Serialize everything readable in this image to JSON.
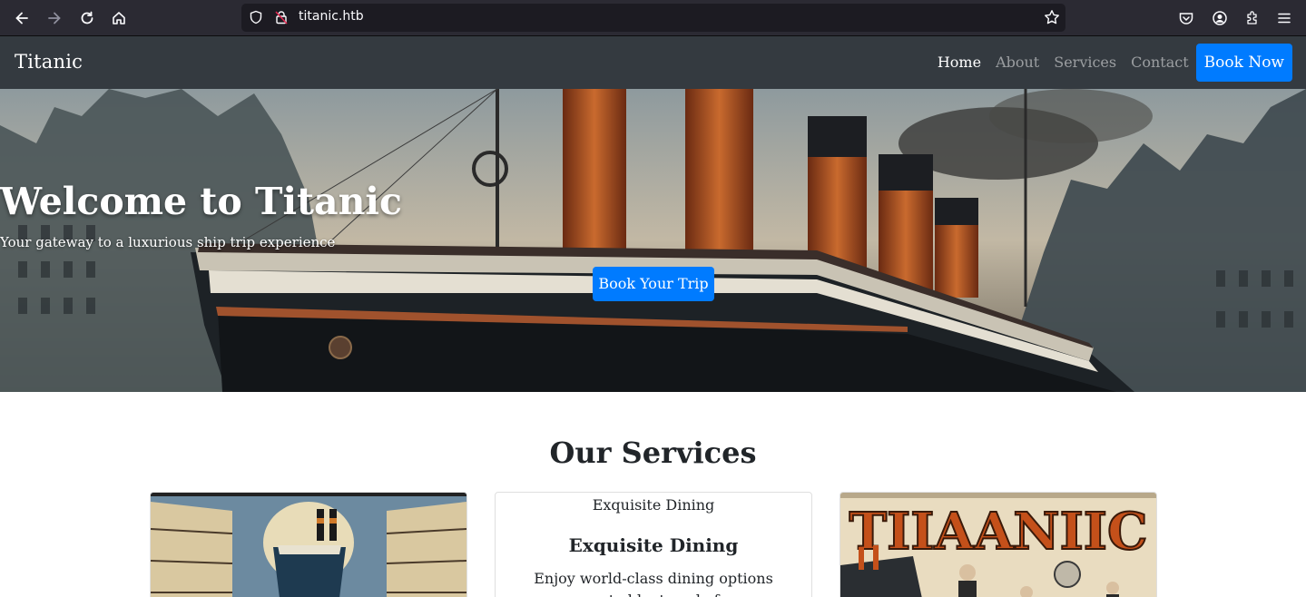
{
  "browser": {
    "url": "titanic.htb"
  },
  "navbar": {
    "brand": "Titanic",
    "links": [
      "Home",
      "About",
      "Services",
      "Contact"
    ],
    "cta": "Book Now"
  },
  "hero": {
    "title": "Welcome to Titanic",
    "subtitle": "Your gateway to a luxurious ship trip experience",
    "button": "Book Your Trip"
  },
  "services": {
    "title": "Our Services",
    "cards": [
      {
        "image_alt": "",
        "image": "ship-between-balconies-illustration"
      },
      {
        "image_alt": "Exquisite Dining",
        "title": "Exquisite Dining",
        "text": "Enjoy world-class dining options curated by top chefs."
      },
      {
        "image_alt": "",
        "image": "titanic-vintage-poster"
      }
    ]
  },
  "colors": {
    "chrome_bg": "#2b2a33",
    "navbar_bg": "#343a40",
    "primary": "#007bff"
  }
}
